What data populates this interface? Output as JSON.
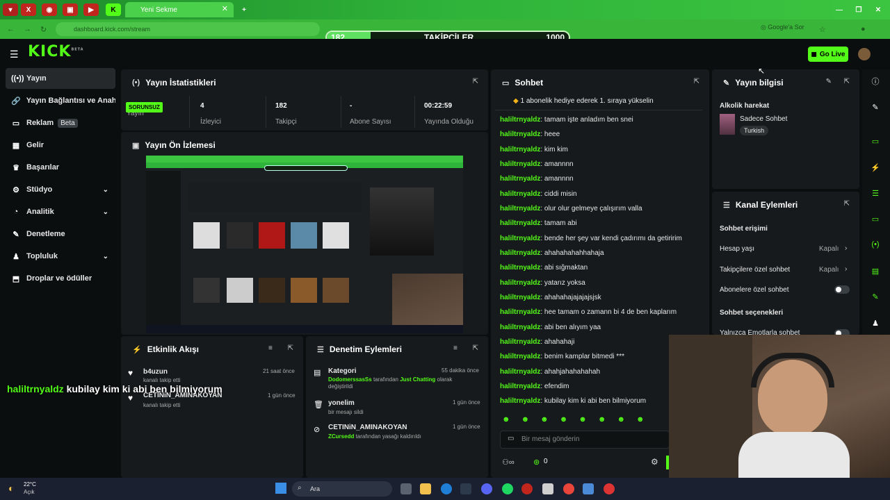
{
  "browser": {
    "tab_title": "Yeni Sekme",
    "url": "dashboard.kick.com/stream",
    "google_button": "Google'a Sor",
    "follower_bar": {
      "current": "182",
      "label": "TAKİPÇİLER",
      "target": "1000",
      "progress": 0.182
    }
  },
  "header": {
    "logo": "KICK",
    "logo_sup": "BETA",
    "go_live": "Go Live"
  },
  "sidebar": {
    "items": [
      {
        "label": "Yayın"
      },
      {
        "label": "Yayın Bağlantısı ve Anahtarı"
      },
      {
        "label": "Reklam",
        "badge": "Beta"
      },
      {
        "label": "Gelir"
      },
      {
        "label": "Başarılar"
      },
      {
        "label": "Stüdyo"
      },
      {
        "label": "Analitik"
      },
      {
        "label": "Denetleme"
      },
      {
        "label": "Topluluk"
      },
      {
        "label": "Droplar ve ödüller"
      }
    ]
  },
  "stats": {
    "title": "Yayın İstatistikleri",
    "status_badge": "SORUNSUZ",
    "status_label": "Yayın",
    "viewers": "4",
    "viewers_label": "İzleyici",
    "followers": "182",
    "followers_label": "Takipçi",
    "subs": "-",
    "subs_label": "Abone Sayısı",
    "duration": "00:22:59",
    "duration_label": "Yayında Olduğu Süre"
  },
  "preview": {
    "title": "Yayın Ön İzlemesi"
  },
  "chat": {
    "title": "Sohbet",
    "pinned": "1 abonelik hediye ederek 1. sıraya yükselin",
    "messages": [
      {
        "user": "haliltrnyaldz",
        "text": "tamam işte anladım ben snei"
      },
      {
        "user": "haliltrnyaldz",
        "text": "heee"
      },
      {
        "user": "haliltrnyaldz",
        "text": "kim kim"
      },
      {
        "user": "haliltrnyaldz",
        "text": "amannnn"
      },
      {
        "user": "haliltrnyaldz",
        "text": "amannnn"
      },
      {
        "user": "haliltrnyaldz",
        "text": "ciddi misin"
      },
      {
        "user": "haliltrnyaldz",
        "text": "olur olur gelmeye çalışırım valla"
      },
      {
        "user": "haliltrnyaldz",
        "text": "tamam abi"
      },
      {
        "user": "haliltrnyaldz",
        "text": "bende her şey var kendi çadırımı da getiririm"
      },
      {
        "user": "haliltrnyaldz",
        "text": "ahahahahahhahaja"
      },
      {
        "user": "haliltrnyaldz",
        "text": "abi sığmaktan"
      },
      {
        "user": "haliltrnyaldz",
        "text": "yatarız yoksa"
      },
      {
        "user": "haliltrnyaldz",
        "text": "ahahahajajajajsjsk"
      },
      {
        "user": "haliltrnyaldz",
        "text": "hee tamam o zamann bi 4 de ben kaplarım"
      },
      {
        "user": "haliltrnyaldz",
        "text": "abi ben alıyım yaa"
      },
      {
        "user": "haliltrnyaldz",
        "text": "ahahahaji"
      },
      {
        "user": "haliltrnyaldz",
        "text": "benim kamplar bitmedi ***"
      },
      {
        "user": "haliltrnyaldz",
        "text": "ahahjahahahahah"
      },
      {
        "user": "haliltrnyaldz",
        "text": "efendim"
      },
      {
        "user": "haliltrnyaldz",
        "text": "kubilay kim ki abi ben bilmiyorum"
      }
    ],
    "input_placeholder": "Bir mesaj gönderin",
    "points": "0"
  },
  "stream_info": {
    "title": "Yayın bilgisi",
    "stream_title": "Alkolik harekat",
    "category": "Sadece Sohbet",
    "language": "Turkish"
  },
  "channel_actions": {
    "title": "Kanal Eylemleri",
    "chat_access": "Sohbet erişimi",
    "account_age": "Hesap yaşı",
    "account_age_value": "Kapalı",
    "followers_only": "Takipçilere özel sohbet",
    "followers_only_value": "Kapalı",
    "subs_only": "Abonelere özel sohbet",
    "chat_options": "Sohbet seçenekleri",
    "emote_only": "Yalnızca Emotlarla sohbet"
  },
  "activity": {
    "title": "Etkinlik Akışı",
    "items": [
      {
        "name": "b4uzun",
        "desc": "kanalı takip etti",
        "time": "21 saat önce"
      },
      {
        "name": "CETINiN_AMINAKOYAN",
        "desc": "kanalı takip etti",
        "time": "1 gün önce"
      }
    ]
  },
  "moderation": {
    "title": "Denetim Eylemleri",
    "items": [
      {
        "name": "Kategori",
        "actor": "DodomerssasSs",
        "mid": "tarafından",
        "target": "Just Chatting",
        "tail": "olarak değiştirildi",
        "time": "55 dakika önce"
      },
      {
        "name": "yonelim",
        "desc": "bir mesajı sildi",
        "time": "1 gün önce"
      },
      {
        "name": "CETINiN_AMINAKOYAN",
        "actor": "ZCursedd",
        "tail": "tarafından yasağı kaldırıldı",
        "time": "1 gün önce"
      }
    ]
  },
  "overlay": {
    "user": "haliltrnyaldz",
    "text": "kubilay kim ki abi ben bilmiyorum"
  },
  "taskbar": {
    "temp": "22°C",
    "weather": "Açık",
    "search": "Ara"
  }
}
